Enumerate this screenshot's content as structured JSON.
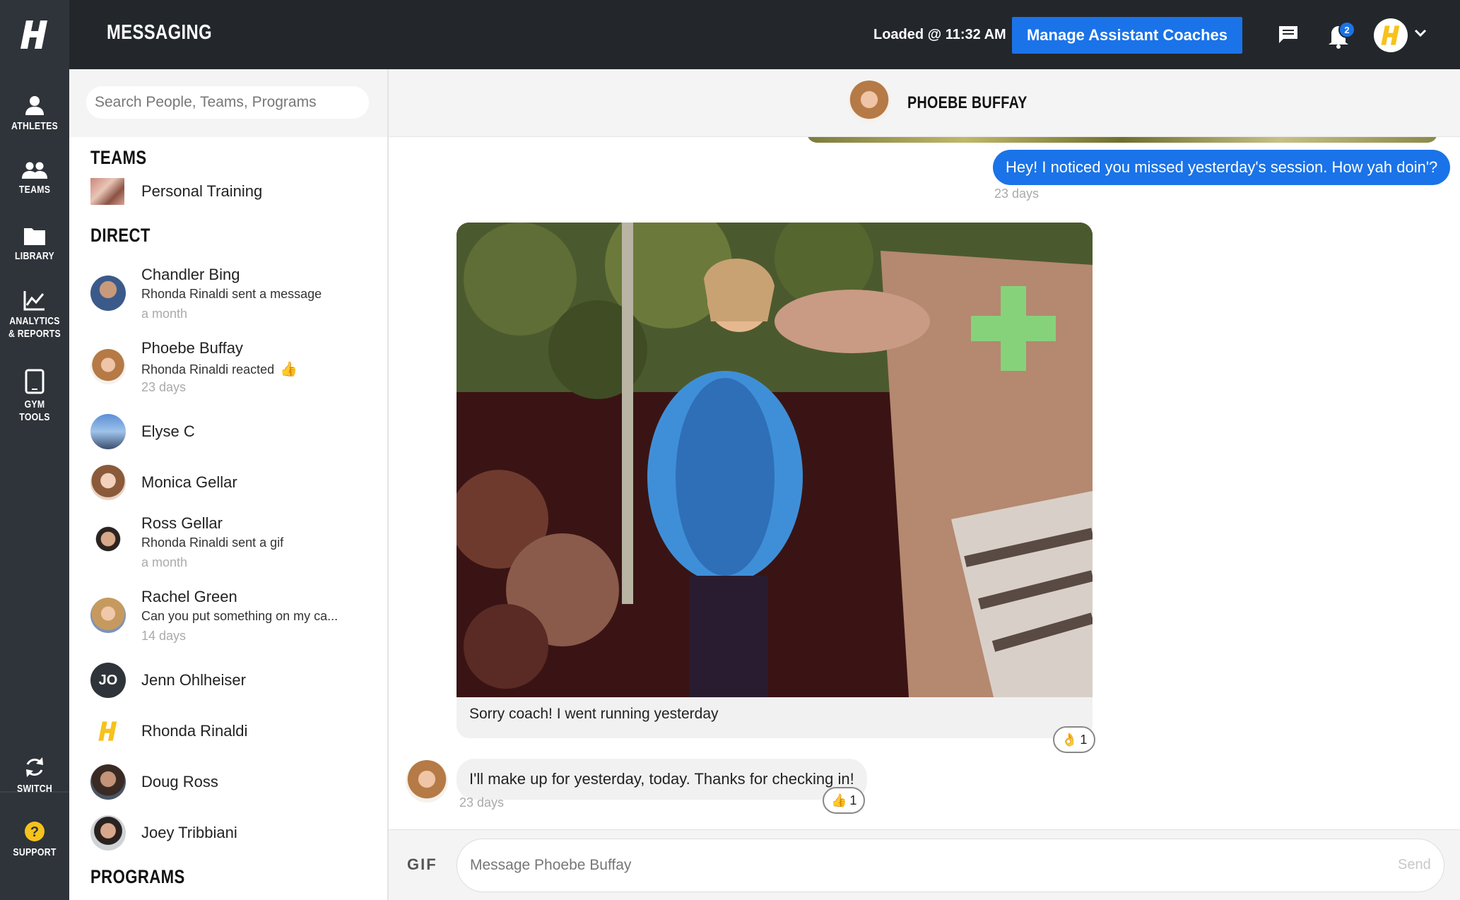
{
  "topbar": {
    "title": "MESSAGING",
    "loaded_text": "Loaded @ 11:32 AM",
    "manage_button": "Manage Assistant Coaches",
    "notification_count": "2",
    "brand_color": "#1a73e8",
    "logo_letter": "H"
  },
  "nav": {
    "items": [
      {
        "label": "ATHLETES",
        "icon": "person-icon"
      },
      {
        "label": "TEAMS",
        "icon": "group-icon"
      },
      {
        "label": "LIBRARY",
        "icon": "folder-icon"
      },
      {
        "label_line1": "ANALYTICS",
        "label_line2": "& REPORTS",
        "icon": "chart-line-icon"
      },
      {
        "label_line1": "GYM",
        "label_line2": "TOOLS",
        "icon": "tablet-icon"
      },
      {
        "label": "SWITCH",
        "icon": "refresh-icon"
      },
      {
        "label": "SUPPORT",
        "icon": "help-icon"
      }
    ]
  },
  "convlist": {
    "search_placeholder": "Search People, Teams, Programs",
    "teams_heading": "TEAMS",
    "teams": [
      {
        "name": "Personal Training"
      }
    ],
    "direct_heading": "DIRECT",
    "direct": [
      {
        "name": "Chandler  Bing",
        "sub": "Rhonda Rinaldi sent a message",
        "time": "a month"
      },
      {
        "name": "Phoebe Buffay",
        "sub": "Rhonda Rinaldi reacted",
        "emoji": "👍",
        "time": "23 days"
      },
      {
        "name": "Elyse C"
      },
      {
        "name": "Monica Gellar"
      },
      {
        "name": "Ross Gellar",
        "sub": "Rhonda Rinaldi sent a gif",
        "time": "a month"
      },
      {
        "name": "Rachel Green",
        "sub": "Can you put something on my ca...",
        "time": "14 days"
      },
      {
        "name": "Jenn Ohlheiser",
        "initials": "JO"
      },
      {
        "name": "Rhonda Rinaldi"
      },
      {
        "name": "Doug Ross"
      },
      {
        "name": "Joey Tribbiani"
      }
    ],
    "programs_heading": "PROGRAMS"
  },
  "chat": {
    "header_name": "PHOEBE BUFFAY",
    "messages": {
      "outgoing_text": "Hey! I noticed you missed yesterday's session. How yah doin'?",
      "outgoing_time": "23 days",
      "gif_caption": "Sorry coach! I went running yesterday",
      "gif_reaction_emoji": "👌",
      "gif_reaction_count": "1",
      "incoming_text": "I'll make up for yesterday, today. Thanks for checking in!",
      "incoming_reaction_emoji": "👍",
      "incoming_reaction_count": "1",
      "incoming_time": "23 days"
    },
    "composer": {
      "gif_label": "GIF",
      "placeholder": "Message Phoebe Buffay",
      "send_label": "Send"
    }
  }
}
